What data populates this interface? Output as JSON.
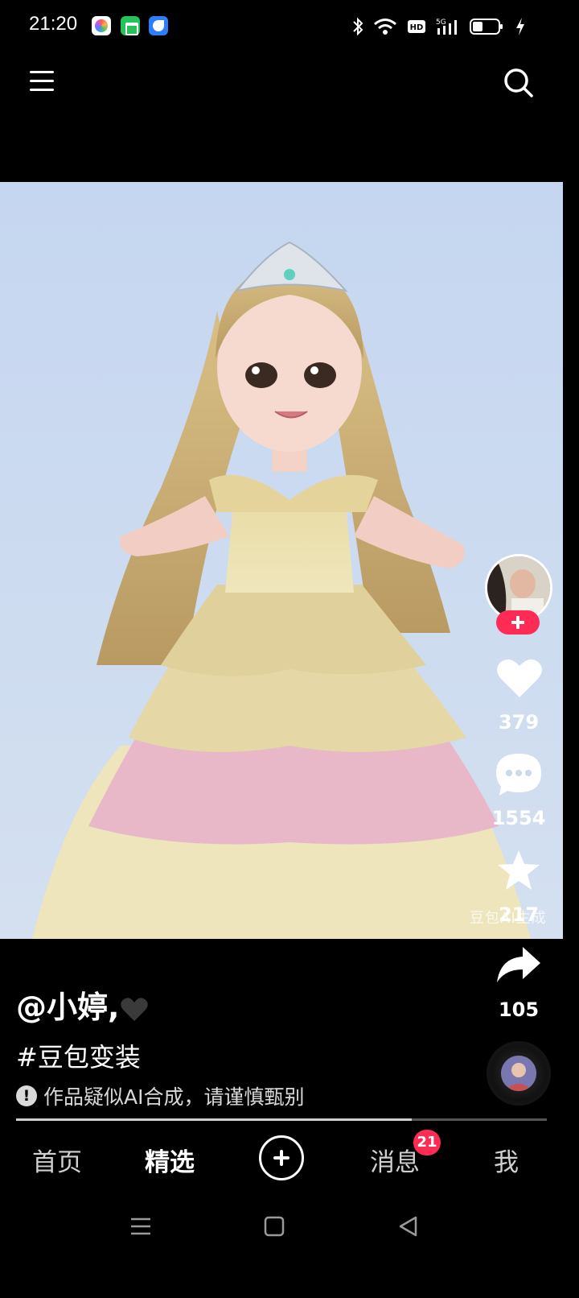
{
  "status_bar": {
    "time": "21:20",
    "app_icons": [
      "ai-app-icon",
      "shopping-bag-icon",
      "browser-icon"
    ],
    "network": "5G",
    "hd": "HD",
    "battery_level": 0.4
  },
  "top_nav": {
    "left_icon": "menu-icon",
    "right_icon": "search-icon"
  },
  "video": {
    "watermark": "豆包AI生成"
  },
  "rail": {
    "follow_icon": "plus-icon",
    "likes": "379",
    "comments": "1554",
    "favorites": "217",
    "shares": "105"
  },
  "post": {
    "username": "@小婷,",
    "hashtag": "#豆包变装",
    "ai_notice": "作品疑似AI合成，请谨慎甄别",
    "progress": 0.745
  },
  "tabs": [
    {
      "label": "首页"
    },
    {
      "label": "精选"
    },
    {
      "label": "消息"
    },
    {
      "label": "我"
    }
  ],
  "messages_badge": "21",
  "colors": {
    "accent": "#fe2c55",
    "background": "#000000",
    "video_bg": "#c9d9f0"
  }
}
